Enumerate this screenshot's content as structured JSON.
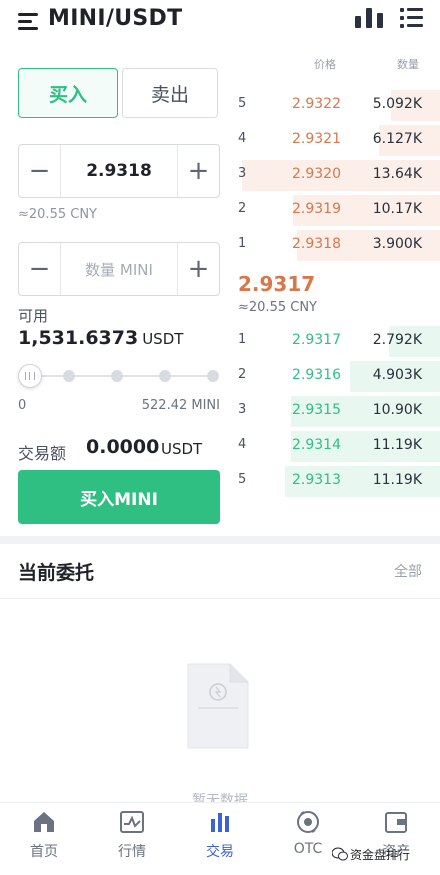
{
  "header": {
    "title": "MINI/USDT",
    "menu_icon": "hamburger-menu-icon",
    "chart_icon": "bar-chart-icon",
    "list_icon": "list-icon"
  },
  "trade": {
    "tab_buy": "买入",
    "tab_sell": "卖出",
    "price_value": "2.9318",
    "price_cny": "≈20.55 CNY",
    "qty_placeholder": "数量 MINI",
    "minus": "−",
    "plus": "+",
    "available_label": "可用",
    "available_value": "1,531.6373",
    "available_unit": "USDT",
    "slider_min": "0",
    "slider_max": "522.42 MINI",
    "slider_level_percent": 0,
    "amount_label": "交易额",
    "amount_value": "0.0000",
    "amount_unit": "USDT",
    "buy_button": "买入MINI"
  },
  "orderbook": {
    "price_header": "价格",
    "qty_header": "数量",
    "asks": [
      {
        "index": "5",
        "price": "2.9322",
        "qty": "5.092K",
        "depth": 0.24
      },
      {
        "index": "4",
        "price": "2.9321",
        "qty": "6.127K",
        "depth": 0.3
      },
      {
        "index": "3",
        "price": "2.9320",
        "qty": "13.64K",
        "depth": 0.97
      },
      {
        "index": "2",
        "price": "2.9319",
        "qty": "10.17K",
        "depth": 0.72
      },
      {
        "index": "1",
        "price": "2.9318",
        "qty": "3.900K",
        "depth": 0.7
      }
    ],
    "last_price": "2.9317",
    "last_price_cny": "≈20.55 CNY",
    "bids": [
      {
        "index": "1",
        "price": "2.9317",
        "qty": "2.792K",
        "depth": 0.25
      },
      {
        "index": "2",
        "price": "2.9316",
        "qty": "4.903K",
        "depth": 0.44
      },
      {
        "index": "3",
        "price": "2.9315",
        "qty": "10.90K",
        "depth": 0.73
      },
      {
        "index": "4",
        "price": "2.9314",
        "qty": "11.19K",
        "depth": 0.73
      },
      {
        "index": "5",
        "price": "2.9313",
        "qty": "11.19K",
        "depth": 0.76
      }
    ],
    "colors": {
      "ask": "#d9774a",
      "bid": "#2fbf83"
    }
  },
  "orders": {
    "title": "当前委托",
    "all_label": "全部",
    "empty_text": "暂无数据",
    "empty_icon": "empty-document-icon"
  },
  "nav": {
    "items": [
      {
        "label": "首页",
        "icon": "home-icon"
      },
      {
        "label": "行情",
        "icon": "market-chart-icon"
      },
      {
        "label": "交易",
        "icon": "trade-bars-icon"
      },
      {
        "label": "OTC",
        "icon": "otc-exchange-icon"
      },
      {
        "label": "资产",
        "icon": "wallet-icon"
      }
    ],
    "active": "交易"
  },
  "watermark": {
    "text": "资金盘排行",
    "icon": "wechat-icon"
  },
  "colors": {
    "accent": "#2fbf83",
    "nav_active": "#3d62d6"
  }
}
